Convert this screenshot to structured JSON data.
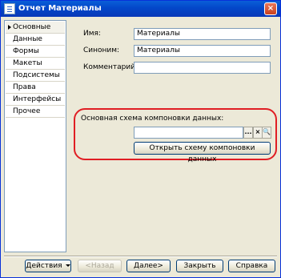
{
  "window": {
    "title": "Отчет Материалы",
    "close_glyph": "×"
  },
  "sidebar": {
    "items": [
      {
        "label": "Основные",
        "active": true
      },
      {
        "label": "Данные"
      },
      {
        "label": "Формы"
      },
      {
        "label": "Макеты"
      },
      {
        "label": "Подсистемы"
      },
      {
        "label": "Права"
      },
      {
        "label": "Интерфейсы"
      },
      {
        "label": "Прочее"
      }
    ]
  },
  "form": {
    "name_label": "Имя:",
    "name_value": "Материалы",
    "synonym_label": "Синоним:",
    "synonym_value": "Материалы",
    "comment_label": "Комментарий:",
    "comment_value": ""
  },
  "schema": {
    "label": "Основная схема компоновки данных:",
    "value": "",
    "select_glyph": "...",
    "clear_glyph": "×",
    "open_glyph": "🔍",
    "open_button": "Открыть схему компоновки данных"
  },
  "footer": {
    "actions": "Действия",
    "back": "<Назад",
    "next": "Далее>",
    "close": "Закрыть",
    "help": "Справка"
  },
  "colors": {
    "highlight": "#e01e24",
    "titlebar": "#0347c9"
  }
}
